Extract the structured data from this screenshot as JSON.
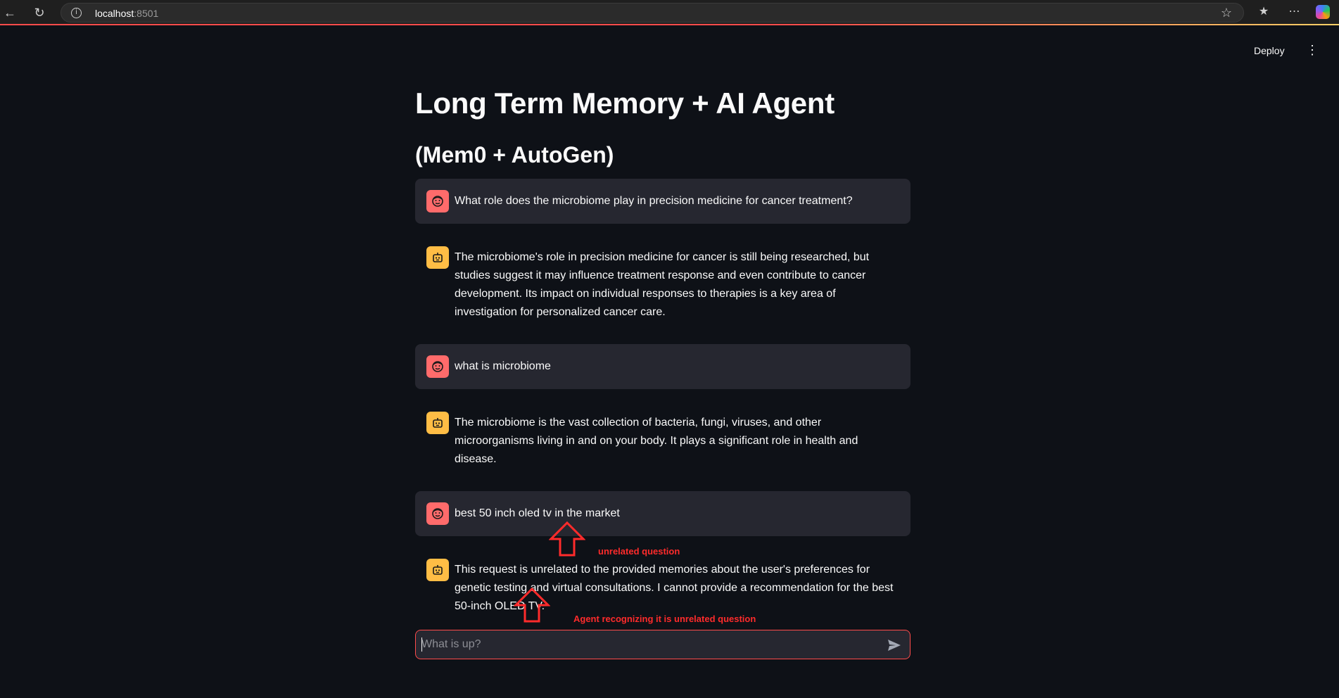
{
  "browser": {
    "url_host": "localhost",
    "url_port": ":8501"
  },
  "header": {
    "deploy_label": "Deploy"
  },
  "main": {
    "title": "Long Term Memory + AI Agent",
    "subtitle": "(Mem0 + AutoGen)"
  },
  "messages": [
    {
      "role": "user",
      "text": "What role does the microbiome play in precision medicine for cancer treatment?"
    },
    {
      "role": "assistant",
      "text": "The microbiome's role in precision medicine for cancer is still being researched, but studies suggest it may influence treatment response and even contribute to cancer development. Its impact on individual responses to therapies is a key area of investigation for personalized cancer care."
    },
    {
      "role": "user",
      "text": "what is microbiome"
    },
    {
      "role": "assistant",
      "text": "The microbiome is the vast collection of bacteria, fungi, viruses, and other microorganisms living in and on your body. It plays a significant role in health and disease."
    },
    {
      "role": "user",
      "text": "best 50 inch oled tv in the market"
    },
    {
      "role": "assistant",
      "text": "This request is unrelated to the provided memories about the user's preferences for genetic testing and virtual consultations. I cannot provide a recommendation for the best 50-inch OLED TV."
    }
  ],
  "annotations": {
    "unrelated_question": "unrelated question",
    "agent_recognizing": "Agent recognizing it is unrelated question",
    "color": "#ff2b2b"
  },
  "chat_input": {
    "placeholder": "What is up?",
    "value": ""
  },
  "colors": {
    "background": "#0e1117",
    "user_bubble": "#262730",
    "user_avatar": "#ff6b6b",
    "bot_avatar": "#ffbd45",
    "accent": "#ff4b4b"
  }
}
